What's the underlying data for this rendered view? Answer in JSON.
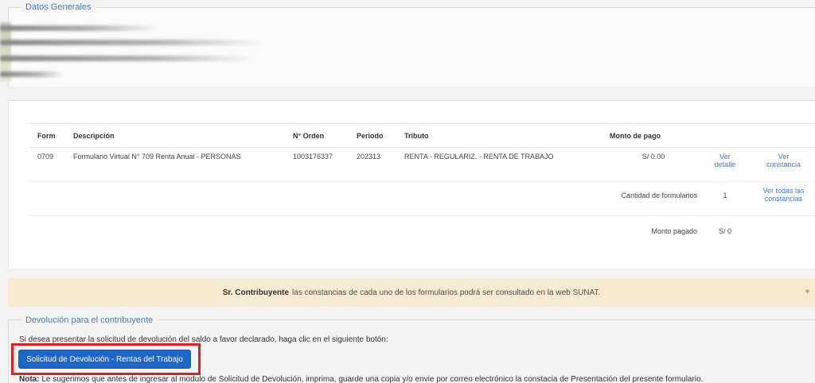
{
  "general": {
    "legend": "Datos Generales"
  },
  "table": {
    "headers": {
      "form": "Form",
      "descripcion": "Descripción",
      "orden": "N° Orden",
      "periodo": "Periodo",
      "tributo": "Tributo",
      "monto": "Monto de pago"
    },
    "row": {
      "form": "0709",
      "descripcion": "Formulario Virtual N° 709 Renta Anual - PERSONAS",
      "orden": "1003176337",
      "periodo": "202313",
      "tributo": "RENTA - REGULARIZ. - RENTA DE TRABAJO",
      "monto": "S/ 0.00",
      "ver_detalle_1": "Ver",
      "ver_detalle_2": "detalle",
      "ver_constancia_1": "Ver",
      "ver_constancia_2": "constancia"
    },
    "summary": {
      "cantidad_label": "Cantidad de formularios",
      "cantidad_value": "1",
      "ver_todas_1": "Ver todas las",
      "ver_todas_2": "constancias",
      "monto_label": "Monto pagado",
      "monto_value": "S/ 0"
    }
  },
  "notice": {
    "bold": "Sr. Contribuyente",
    "text": "las constancias de cada uno de los formularios podrá ser consultado en la web SUNAT."
  },
  "devolucion": {
    "legend": "Devolución para el contribuyente",
    "instruction": "Si desea presentar la solicitud de devolución del saldo a favor declarado, haga clic en el siguiente botón:",
    "button_label": "Solicitud de Devolución - Rentas del Trabajo",
    "nota_label": "Nota:",
    "nota_text": "Le sugerimos que antes de ingresar al modulo de Solicitud de Devolución, imprima, guarde una copia y/o envie por correo electrónico la constacia de Presentación del presente formulario."
  },
  "colors": {
    "accent": "#1f66c9",
    "link": "#3d7bc0",
    "highlight": "#e02020",
    "notice_bg": "#f5ebd0"
  }
}
